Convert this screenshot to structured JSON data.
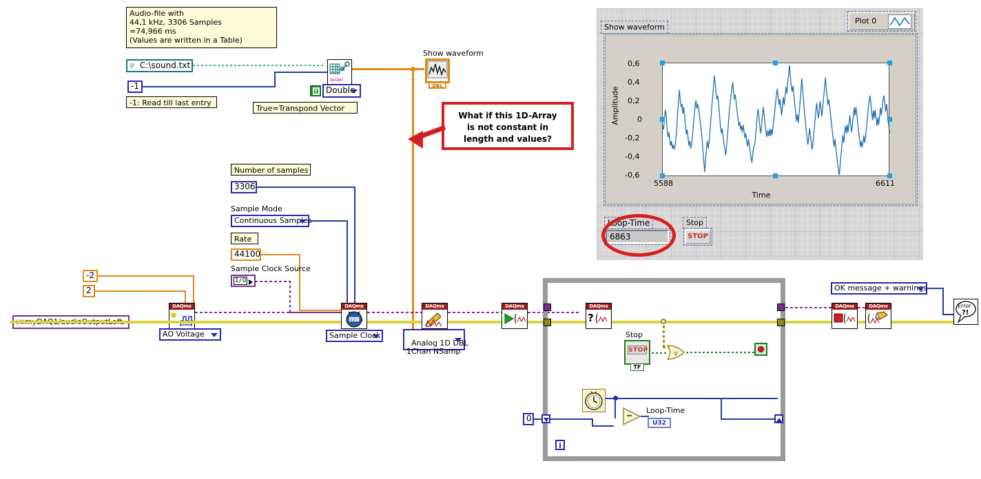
{
  "comments": {
    "audio_file_note": "Audio-file with\n44,1 kHz, 3306 Samples\n=74,966 ms\n(Values are written in a Table)",
    "read_till_last_entry": "-1: Read till last entry",
    "transpond_vector": "True=Transpond Vector",
    "number_of_samples": "Number of samples",
    "rate": "Rate",
    "callout": "What if this 1D-Array\nis not constant in\nlength and values?"
  },
  "labels": {
    "sample_mode": "Sample Mode",
    "sample_clock_source": "Sample Clock Source",
    "show_waveform_diagram": "Show waveform",
    "stop_in_loop": "Stop",
    "loop_time_in_loop": "Loop-Time"
  },
  "constants": {
    "file_path": "C:\\sound.txt",
    "read_rows": "-1",
    "number_of_samples": "3306",
    "rate": "44100",
    "min_value": "-2",
    "max_value": "2",
    "shift_register_init": "0",
    "representation": "U32",
    "iteration": "i"
  },
  "rings": {
    "double": "Double",
    "sample_mode": "Continuous Samples",
    "ao_voltage": "AO Voltage",
    "sample_clock": "Sample Clock",
    "analog_1d_dbl": "Analog 1D DBL\n1Chan NSamp",
    "error_handler": "OK message + warnings",
    "physical_channel": "myDAQ1/audioOutputLeft",
    "sample_clock_source": "I/O"
  },
  "front_panel": {
    "show_waveform_label": "Show waveform",
    "plot_legend": "Plot 0",
    "loop_time_label": "Loop-Time",
    "loop_time_value": "6863",
    "stop_label": "Stop",
    "stop_button": "STOP"
  },
  "colors": {
    "wire_orange": "#e08a14",
    "wire_blue": "#2626b0",
    "wire_purple": "#7b2d8e",
    "wire_error_yellow": "#d8d23c",
    "wire_green": "#1e7b1e",
    "plot_line": "#1f6fb4",
    "callout_red": "#d32020",
    "annotation_red": "#d81e1e",
    "comment_bg": "#fdfbd8",
    "loop_border": "#9a9a9a"
  },
  "icons": {
    "read_spreadsheet": "read-from-spreadsheet-file-icon",
    "waveform_graph_indicator": "waveform-graph-indicator-icon",
    "daqmx_create_channel": "daqmx-create-virtual-channel-icon",
    "daqmx_timing": "daqmx-timing-clock-icon",
    "daqmx_write": "daqmx-write-pencil-icon",
    "daqmx_start": "daqmx-start-task-play-icon",
    "daqmx_is_task_done": "daqmx-is-task-done-question-icon",
    "daqmx_stop": "daqmx-stop-task-square-icon",
    "daqmx_clear": "daqmx-clear-task-eraser-icon",
    "error_handler": "simple-error-handler-icon",
    "tick_count": "tick-count-timer-icon",
    "or_gate": "or-gate-icon",
    "subtract": "subtract-function-icon",
    "loop_stop": "loop-stop-condition-icon"
  },
  "chart_data": {
    "type": "line",
    "title": "",
    "xlabel": "Time",
    "ylabel": "Amplitude",
    "legend": [
      "Plot 0"
    ],
    "legend_position": "top-right",
    "grid": false,
    "xlim": [
      5588,
      6611
    ],
    "ylim": [
      -0.6,
      0.6
    ],
    "xticks": [
      "5588",
      "6611"
    ],
    "yticks": [
      "0,6",
      "0,4",
      "0,2",
      "0",
      "-0,2",
      "-0,4",
      "-0,6"
    ],
    "series": [
      {
        "name": "Plot 0",
        "values": [
          -0.06,
          -0.1,
          0.02,
          0.11,
          0.05,
          -0.09,
          -0.18,
          -0.13,
          -0.21,
          -0.27,
          -0.22,
          -0.3,
          -0.26,
          -0.31,
          -0.28,
          -0.2,
          -0.09,
          0.07,
          0.19,
          0.32,
          0.22,
          0.14,
          0.17,
          0.07,
          0.14,
          0.04,
          -0.06,
          -0.15,
          -0.1,
          -0.19,
          -0.27,
          -0.22,
          -0.3,
          -0.26,
          -0.17,
          -0.06,
          0.05,
          0.15,
          0.21,
          0.12,
          0.17,
          0.13,
          0.06,
          -0.02,
          -0.1,
          -0.2,
          -0.32,
          -0.44,
          -0.55,
          -0.42,
          -0.3,
          -0.22,
          -0.3,
          -0.23,
          -0.12,
          0.0,
          0.12,
          0.24,
          0.34,
          0.47,
          0.39,
          0.28,
          0.22,
          0.26,
          0.17,
          0.05,
          -0.06,
          -0.14,
          -0.09,
          -0.17,
          -0.25,
          -0.31,
          -0.37,
          -0.28,
          -0.17,
          -0.05,
          0.08,
          0.17,
          0.26,
          0.33,
          0.4,
          0.3,
          0.22,
          0.27,
          0.18,
          0.1,
          0.02,
          -0.06,
          -0.02,
          -0.1,
          -0.06,
          -0.13,
          -0.05,
          -0.12,
          -0.19,
          -0.14,
          -0.22,
          -0.28,
          -0.2,
          -0.26,
          -0.33,
          -0.4,
          -0.45,
          -0.36,
          -0.28,
          -0.27,
          -0.2,
          -0.08,
          0.03,
          0.12,
          0.04,
          -0.06,
          -0.14,
          -0.06,
          0.05,
          0.14,
          0.05,
          -0.04,
          -0.12,
          -0.18,
          -0.11,
          -0.17,
          -0.1,
          -0.17,
          -0.09,
          -0.16,
          -0.08,
          -0.01,
          0.08,
          0.18,
          0.27,
          0.33,
          0.24,
          0.16,
          0.22,
          0.14,
          0.05,
          0.15,
          0.24,
          0.16,
          0.26,
          0.35,
          0.28,
          0.4,
          0.48,
          0.58,
          0.46,
          0.36,
          0.3,
          0.36,
          0.27,
          0.17,
          0.08,
          -0.01,
          0.06,
          -0.03,
          0.07,
          0.18,
          0.3,
          0.44,
          0.32,
          0.21,
          0.1,
          0.0,
          -0.1,
          -0.18,
          -0.26,
          -0.18,
          -0.09,
          -0.17,
          -0.25,
          -0.31,
          -0.22,
          -0.12,
          -0.02,
          0.08,
          0.18,
          0.1,
          0.02,
          0.11,
          0.2,
          0.12,
          0.04,
          0.14,
          0.24,
          0.33,
          0.45,
          0.34,
          0.24,
          0.16,
          0.22,
          0.14,
          0.05,
          -0.04,
          -0.12,
          -0.2,
          -0.28,
          -0.2,
          -0.3,
          -0.38,
          -0.46,
          -0.54,
          -0.58,
          -0.46,
          -0.36,
          -0.26,
          -0.16,
          -0.24,
          -0.14,
          -0.06,
          -0.14,
          -0.05,
          -0.13,
          -0.04,
          0.05,
          -0.04,
          -0.13,
          -0.05,
          0.04,
          0.13,
          0.05,
          0.14,
          0.06,
          -0.03,
          -0.12,
          -0.2,
          -0.28,
          -0.22,
          -0.29,
          -0.24,
          -0.16,
          -0.24,
          -0.18,
          -0.08,
          0.02,
          0.12,
          0.2,
          0.26,
          0.18,
          0.09,
          0.0,
          0.1,
          0.02,
          0.11,
          0.02,
          -0.06,
          0.03,
          -0.05,
          0.04,
          0.13,
          0.05,
          0.14,
          0.22,
          0.26,
          0.18,
          0.09,
          0.17,
          0.08,
          -0.02,
          -0.1,
          -0.14
        ]
      }
    ]
  }
}
